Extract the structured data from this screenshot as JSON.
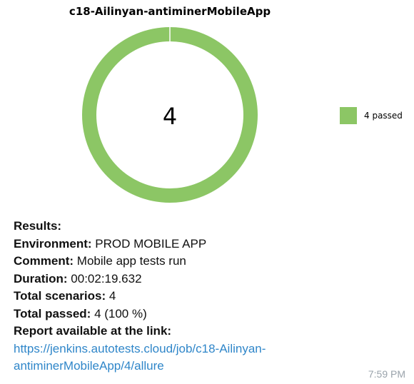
{
  "chart_data": {
    "type": "pie",
    "title": "c18-Ailinyan-antiminerMobileApp",
    "center_label": "4",
    "slices": [
      {
        "name": "4 passed",
        "value": 4,
        "color": "#8cc665"
      }
    ],
    "legend": [
      "4 passed"
    ],
    "legend_position": "right"
  },
  "results": {
    "heading": "Results:",
    "environment_label": "Environment:",
    "environment_value": "PROD MOBILE APP",
    "comment_label": "Comment:",
    "comment_value": "Mobile app tests run",
    "duration_label": "Duration:",
    "duration_value": "00:02:19.632",
    "scenarios_label": "Total scenarios:",
    "scenarios_value": "4",
    "passed_label": "Total passed:",
    "passed_value": "4 (100 %)",
    "report_label": "Report available at the link:",
    "link_line1": "https://jenkins.autotests.cloud/job/c18-Ailinyan-",
    "link_line2": "antiminerMobileApp/4/allure"
  },
  "message": {
    "time": "7:59 PM"
  }
}
